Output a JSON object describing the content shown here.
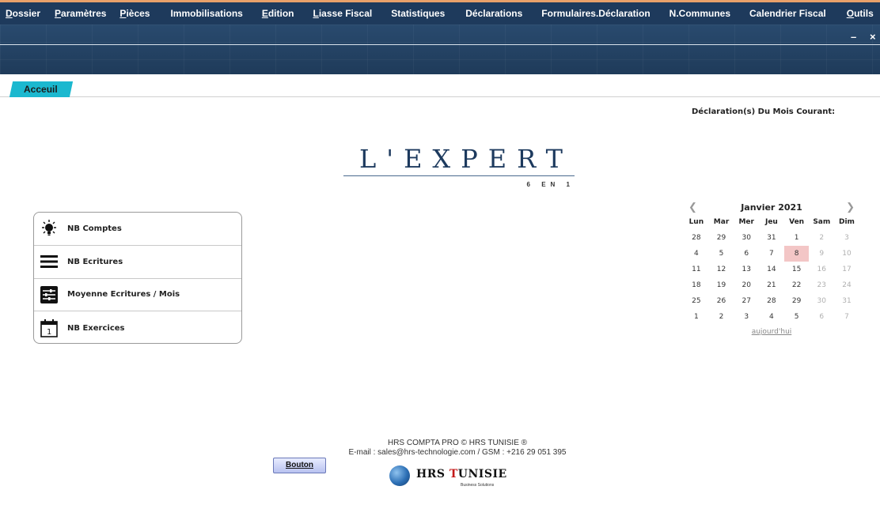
{
  "menu": {
    "items": [
      {
        "label": "Dossier",
        "underline": true
      },
      {
        "label": "Paramètres",
        "underline": true
      },
      {
        "label": "Pièces",
        "underline": true
      },
      {
        "label": "Immobilisations",
        "underline": false
      },
      {
        "label": "Edition",
        "underline": true
      },
      {
        "label": "Liasse Fiscal",
        "underline": true
      },
      {
        "label": "Statistiques",
        "underline": false
      },
      {
        "label": "Déclarations",
        "underline": false
      },
      {
        "label": "Formulaires.Déclaration",
        "underline": false
      },
      {
        "label": "N.Communes",
        "underline": false
      },
      {
        "label": "Calendrier Fiscal",
        "underline": false
      },
      {
        "label": "Outils",
        "underline": true
      }
    ],
    "minimize_icon": "minimize-icon",
    "close_icon": "close-icon"
  },
  "tabs": {
    "active_label": "Acceuil"
  },
  "logo": {
    "title": "L'EXPERT",
    "subtitle": "6 EN 1"
  },
  "stats": {
    "items": [
      {
        "label": "NB Comptes",
        "icon": "lightbulb-icon"
      },
      {
        "label": "NB Ecritures",
        "icon": "menu-lines-icon"
      },
      {
        "label": "Moyenne Ecritures / Mois",
        "icon": "sliders-icon"
      },
      {
        "label": "NB Exercices",
        "icon": "calendar-icon"
      }
    ]
  },
  "declarations": {
    "title": "Déclaration(s) Du Mois Courant:"
  },
  "calendar": {
    "month_title": "Janvier 2021",
    "weekdays": [
      "Lun",
      "Mar",
      "Mer",
      "Jeu",
      "Ven",
      "Sam",
      "Dim"
    ],
    "weeks": [
      [
        "28",
        "29",
        "30",
        "31",
        "1",
        "2",
        "3"
      ],
      [
        "4",
        "5",
        "6",
        "7",
        "8",
        "9",
        "10"
      ],
      [
        "11",
        "12",
        "13",
        "14",
        "15",
        "16",
        "17"
      ],
      [
        "18",
        "19",
        "20",
        "21",
        "22",
        "23",
        "24"
      ],
      [
        "25",
        "26",
        "27",
        "28",
        "29",
        "30",
        "31"
      ],
      [
        "1",
        "2",
        "3",
        "4",
        "5",
        "6",
        "7"
      ]
    ],
    "today_label": "aujourd'hui",
    "today_highlight": "8",
    "highlight_color": "#f3c6c6"
  },
  "footer": {
    "line1": "HRS COMPTA PRO © HRS TUNISIE ®",
    "line2": "E-mail : sales@hrs-technologie.com / GSM : +216 29 051 395",
    "button_label": "Bouton",
    "brand_prefix": "HRS ",
    "brand_t": "T",
    "brand_rest": "UNISIE",
    "brand_tagline": "Business Solutions"
  },
  "colors": {
    "menubar": "#1e3a5c",
    "tab_accent": "#1bb8cf",
    "logo_text": "#1d3a5e"
  }
}
